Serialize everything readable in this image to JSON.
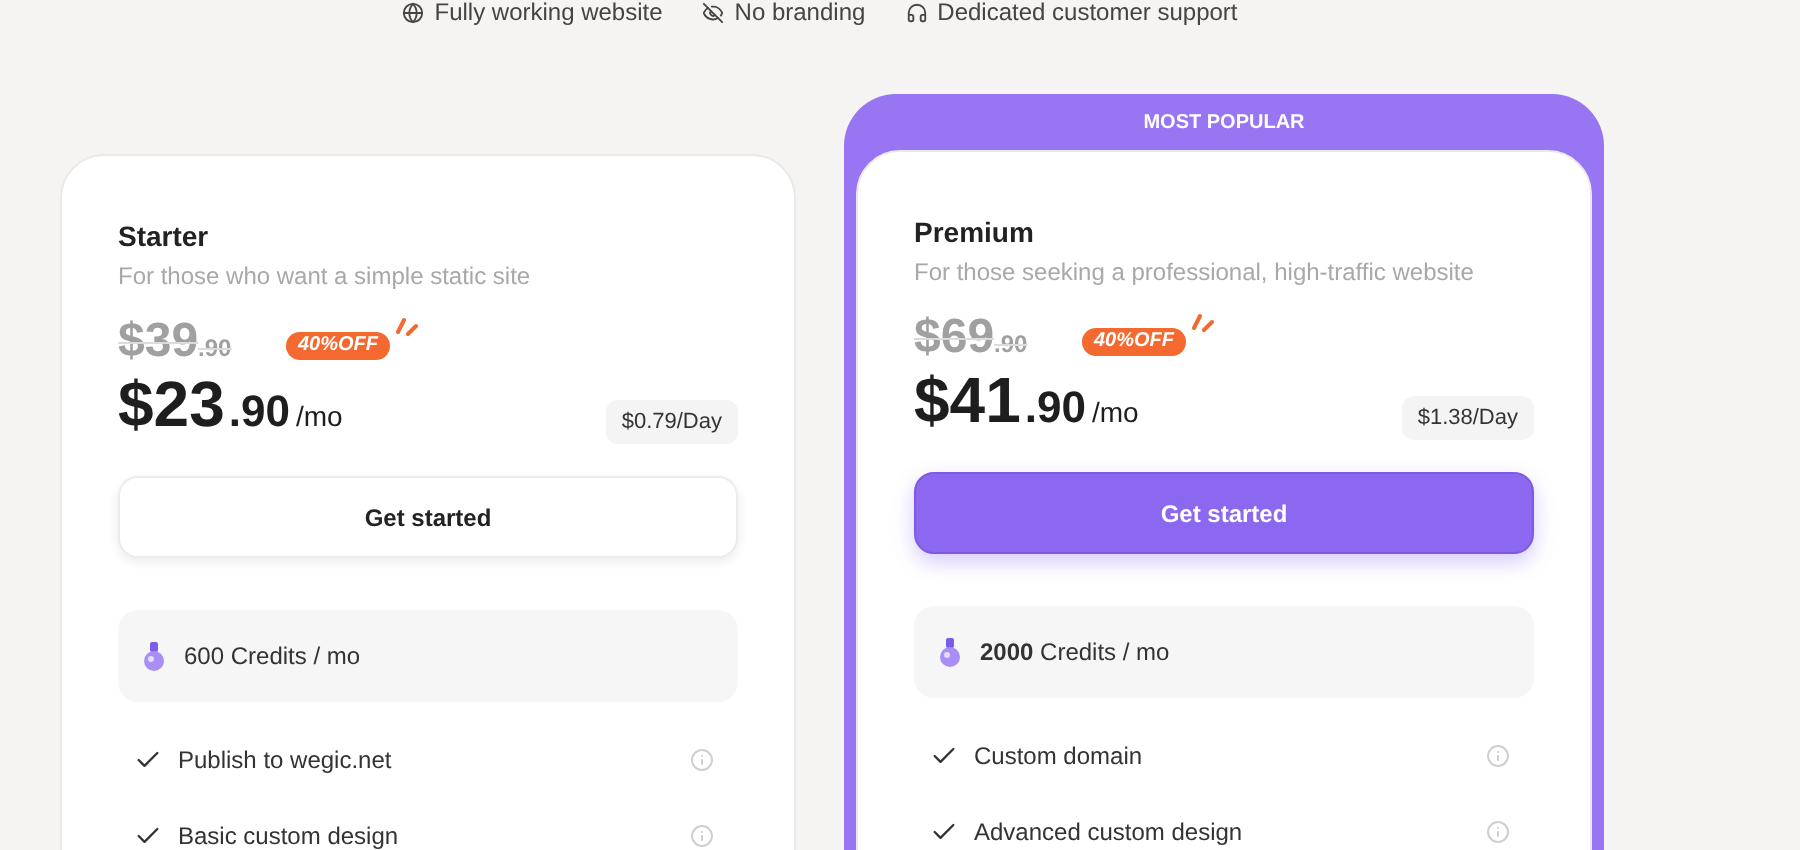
{
  "perks": [
    {
      "kind": "globe",
      "label": "Fully working website"
    },
    {
      "kind": "eye-off",
      "label": "No branding"
    },
    {
      "kind": "headphones",
      "label": "Dedicated customer support"
    }
  ],
  "plans": [
    {
      "name": "Starter",
      "featured": false,
      "description": "For those who want a simple static site",
      "old_price": "$39",
      "old_cents": ".90",
      "discount": "40%OFF",
      "price": "$23",
      "cents": ".90",
      "period": "/mo",
      "per_day": "$0.79/Day",
      "button": "Get started",
      "credits": "600 Credits / mo",
      "features": [
        "Publish to wegic.net",
        "Basic custom design"
      ]
    },
    {
      "name": "Premium",
      "featured": true,
      "banner": "MOST POPULAR",
      "description": "For those seeking a professional, high-traffic website",
      "old_price": "$69",
      "old_cents": ".90",
      "discount": "40%OFF",
      "price": "$41",
      "cents": ".90",
      "period": "/mo",
      "per_day": "$1.38/Day",
      "button": "Get started",
      "credits": "**2000** Credits / mo",
      "features": [
        "Custom domain",
        "Advanced custom design"
      ]
    }
  ]
}
